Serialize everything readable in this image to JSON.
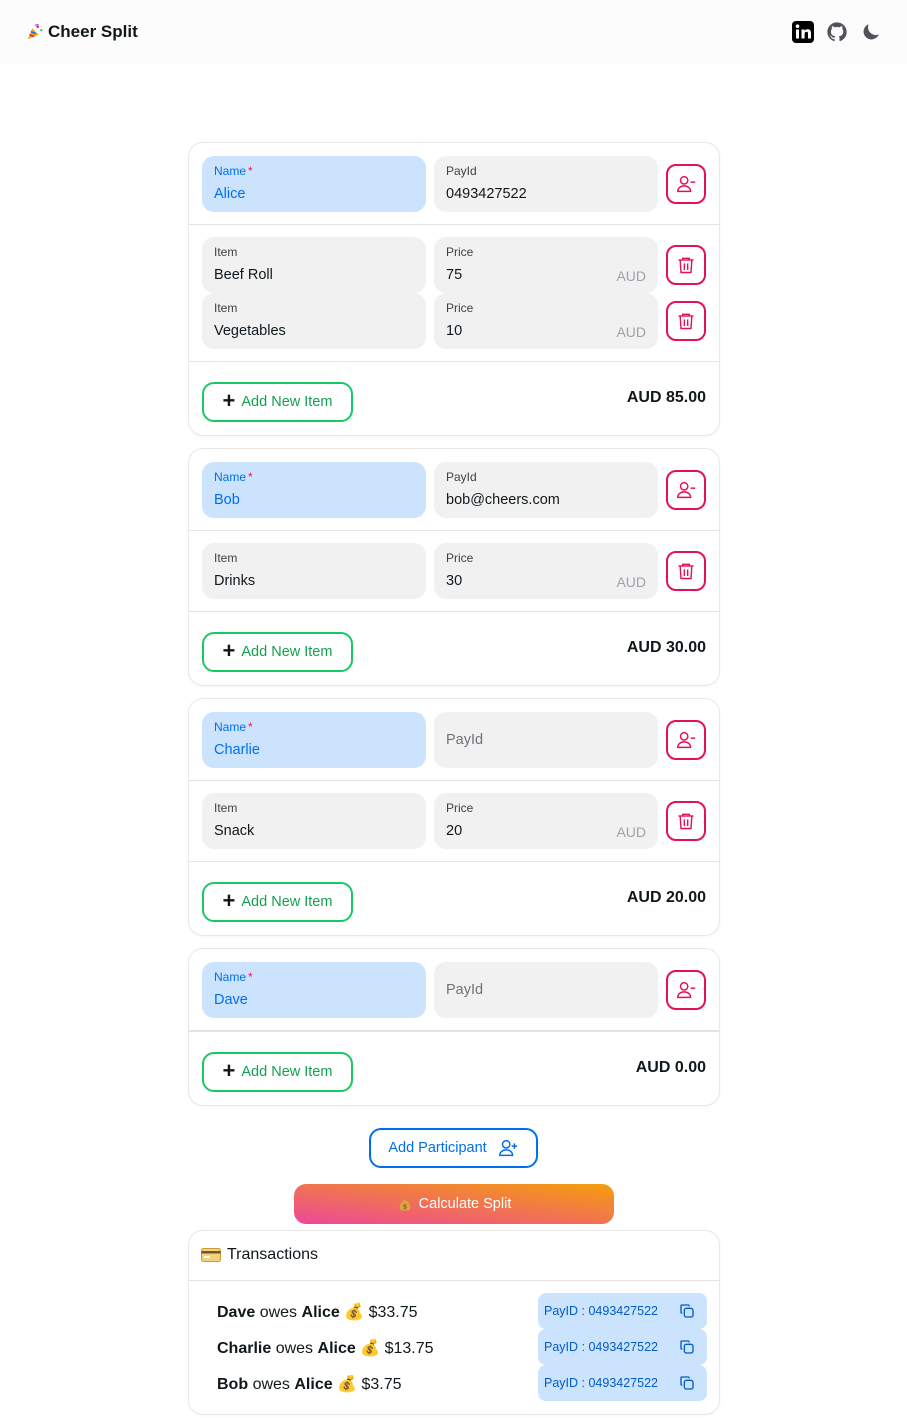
{
  "app": {
    "title": "Cheer Split",
    "logo_icon": "party-popper-icon"
  },
  "nav": {
    "icons": [
      "linkedin-icon",
      "github-icon",
      "moon-icon"
    ]
  },
  "labels": {
    "name": "Name",
    "required_mark": "*",
    "payid": "PayId",
    "item": "Item",
    "price": "Price",
    "currency": "AUD",
    "add_item": "Add New Item"
  },
  "participants": [
    {
      "name": "Alice",
      "payid": "0493427522",
      "items": [
        {
          "item": "Beef Roll",
          "price": "75"
        },
        {
          "item": "Vegetables",
          "price": "10"
        }
      ],
      "total": "AUD 85.00"
    },
    {
      "name": "Bob",
      "payid": "bob@cheers.com",
      "items": [
        {
          "item": "Drinks",
          "price": "30"
        }
      ],
      "total": "AUD 30.00"
    },
    {
      "name": "Charlie",
      "payid": "",
      "items": [
        {
          "item": "Snack",
          "price": "20"
        }
      ],
      "total": "AUD 20.00"
    },
    {
      "name": "Dave",
      "payid": "",
      "items": [],
      "total": "AUD 0.00"
    }
  ],
  "actions": {
    "add_participant": "Add Participant",
    "calculate": "Calculate Split",
    "calculate_icon": "money-bag-icon"
  },
  "transactions": {
    "title": "Transactions",
    "title_icon": "credit-card-icon",
    "owes_word": "owes",
    "items": [
      {
        "from": "Dave",
        "to": "Alice",
        "amount": "$33.75",
        "payid": "PayID : 0493427522"
      },
      {
        "from": "Charlie",
        "to": "Alice",
        "amount": "$13.75",
        "payid": "PayID : 0493427522"
      },
      {
        "from": "Bob",
        "to": "Alice",
        "amount": "$3.75",
        "payid": "PayID : 0493427522"
      }
    ]
  },
  "colors": {
    "primary": "#006fee",
    "danger": "#e5105a",
    "success": "#17c964",
    "gradient_start": "#ec4899",
    "gradient_end": "#f59e0b"
  }
}
